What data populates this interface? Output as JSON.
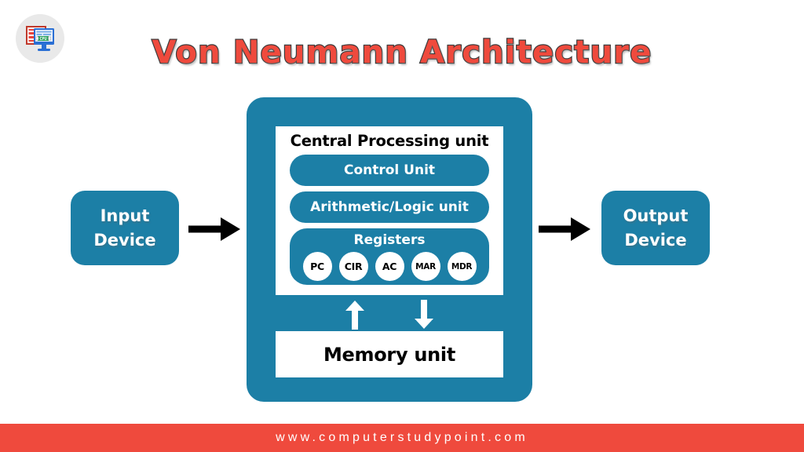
{
  "logo": {
    "name": "computer-study-point-logo",
    "screen_text": "CPU",
    "alt": "computer monitor icon"
  },
  "title": "Von Neumann Architecture",
  "colors": {
    "accent_blue": "#1c7fa6",
    "accent_red": "#ef4a3d",
    "white": "#ffffff",
    "black": "#000000",
    "logo_circle": "#e9e9e9"
  },
  "diagram": {
    "input_device": {
      "line1": "Input",
      "line2": "Device"
    },
    "output_device": {
      "line1": "Output",
      "line2": "Device"
    },
    "cpu": {
      "title": "Central Processing unit",
      "control_unit": "Control Unit",
      "alu": "Arithmetic/Logic unit",
      "registers_title": "Registers",
      "registers": [
        "PC",
        "CIR",
        "AC",
        "MAR",
        "MDR"
      ]
    },
    "memory": {
      "label": "Memory unit"
    },
    "arrows": {
      "input_to_cpu": "arrow-right",
      "cpu_to_output": "arrow-right",
      "memory_read": "arrow-up",
      "memory_write": "arrow-down"
    }
  },
  "footer": {
    "url": "www.computerstudypoint.com"
  }
}
